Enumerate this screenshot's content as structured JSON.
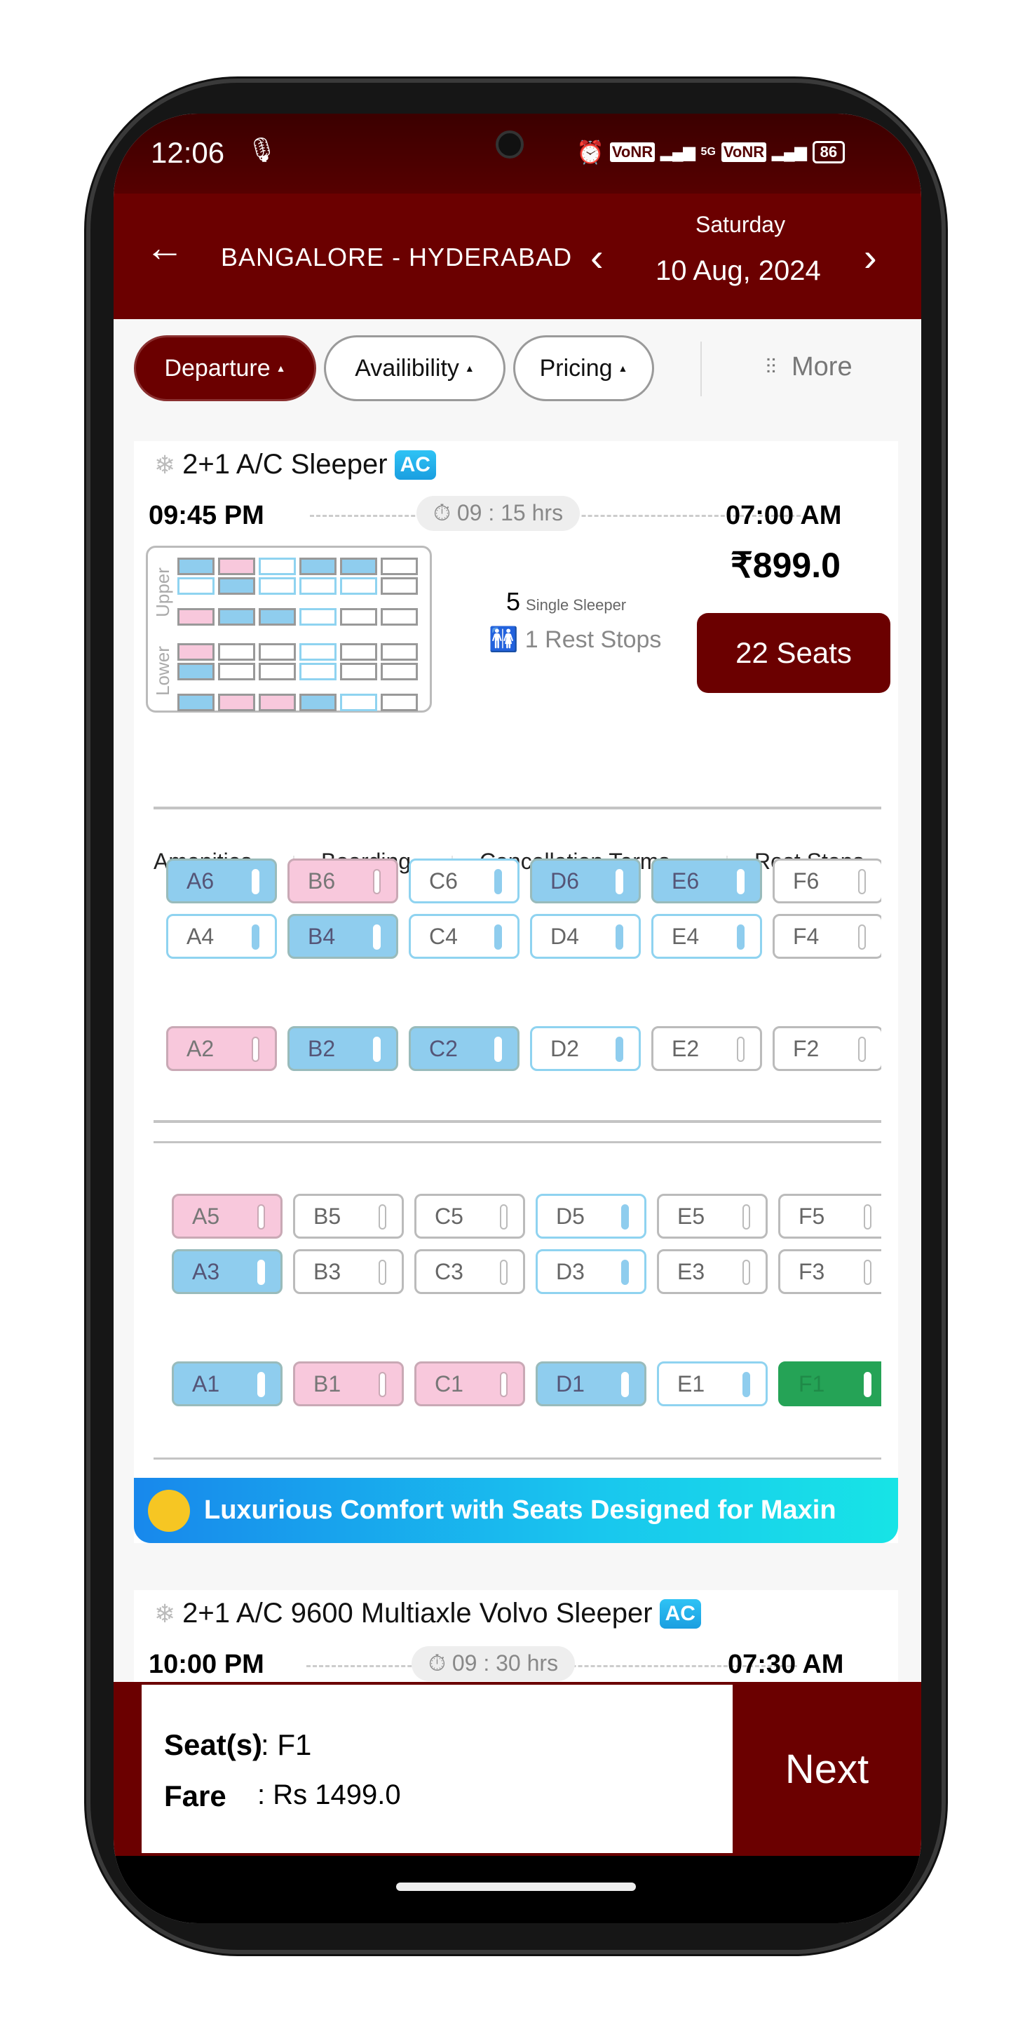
{
  "status_bar": {
    "time": "12:06",
    "battery": "86",
    "network_labels": [
      "VoNR",
      "5G",
      "VoNR"
    ]
  },
  "header": {
    "route": "BANGALORE - HYDERABAD",
    "day": "Saturday",
    "date": "10 Aug, 2024"
  },
  "filters": [
    {
      "label": "Departure",
      "active": true
    },
    {
      "label": "Availibility",
      "active": false
    },
    {
      "label": "Pricing",
      "active": false
    }
  ],
  "more_label": "More",
  "bus1": {
    "name": "2+1 A/C Sleeper",
    "ac_badge": "AC",
    "departure": "09:45 PM",
    "duration": "09 : 15 hrs",
    "arrival": "07:00 AM",
    "price": "₹899.0",
    "single_count": "5",
    "single_label": "Single Sleeper",
    "rest_stops": "1 Rest Stops",
    "seats_button": "22 Seats",
    "deck_upper": "Upper",
    "deck_lower": "Lower",
    "tabs": [
      "Amenities",
      "Boarding",
      "Cancellation Terms",
      "Rest Stops"
    ],
    "upper_rows": [
      [
        [
          "A6",
          "booked"
        ],
        [
          "B6",
          "ladies"
        ],
        [
          "C6",
          "available"
        ],
        [
          "D6",
          "booked"
        ],
        [
          "E6",
          "booked"
        ],
        [
          "F6",
          "unavailable"
        ]
      ],
      [
        [
          "A4",
          "available"
        ],
        [
          "B4",
          "booked"
        ],
        [
          "C4",
          "available"
        ],
        [
          "D4",
          "available"
        ],
        [
          "E4",
          "available"
        ],
        [
          "F4",
          "unavailable"
        ]
      ],
      [
        [
          "A2",
          "ladies"
        ],
        [
          "B2",
          "booked"
        ],
        [
          "C2",
          "booked"
        ],
        [
          "D2",
          "available"
        ],
        [
          "E2",
          "unavailable"
        ],
        [
          "F2",
          "unavailable"
        ]
      ]
    ],
    "lower_rows": [
      [
        [
          "A5",
          "ladies"
        ],
        [
          "B5",
          "unavailable"
        ],
        [
          "C5",
          "unavailable"
        ],
        [
          "D5",
          "available"
        ],
        [
          "E5",
          "unavailable"
        ],
        [
          "F5",
          "unavailable"
        ]
      ],
      [
        [
          "A3",
          "booked"
        ],
        [
          "B3",
          "unavailable"
        ],
        [
          "C3",
          "unavailable"
        ],
        [
          "D3",
          "available"
        ],
        [
          "E3",
          "unavailable"
        ],
        [
          "F3",
          "unavailable"
        ]
      ],
      [
        [
          "A1",
          "booked"
        ],
        [
          "B1",
          "ladies"
        ],
        [
          "C1",
          "ladies"
        ],
        [
          "D1",
          "booked"
        ],
        [
          "E1",
          "available"
        ],
        [
          "F1",
          "selected"
        ]
      ]
    ],
    "banner": "Luxurious Comfort with Seats Designed for Maxin"
  },
  "bus2": {
    "name": "2+1 A/C 9600 Multiaxle Volvo Sleeper",
    "ac_badge": "AC",
    "departure": "10:00 PM",
    "duration": "09 : 30 hrs",
    "arrival": "07:30 AM"
  },
  "summary": {
    "seats_label": "Seat(s)",
    "seats_value": "F1",
    "fare_label": "Fare",
    "fare_value": "Rs 1499.0",
    "next_label": "Next"
  },
  "colors": {
    "primary": "#6b0000",
    "booked": "#8fcdee",
    "ladies": "#f8c8dc",
    "selected": "#25a356",
    "available_border": "#8fd3f0"
  }
}
